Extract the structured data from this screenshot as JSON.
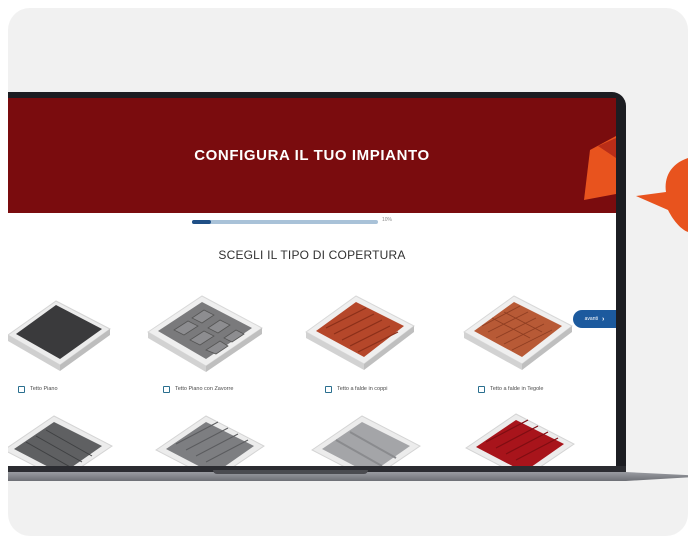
{
  "hero": {
    "title": "CONFIGURA IL TUO IMPIANTO"
  },
  "progress": {
    "value_fraction": 0.1,
    "label": "10%"
  },
  "section": {
    "title": "SCEGLI IL TIPO DI COPERTURA"
  },
  "options": [
    {
      "label": "Tetto Piano",
      "icon": "flat-roof-icon"
    },
    {
      "label": "Tetto Piano con Zavorre",
      "icon": "ballasted-flat-roof-icon"
    },
    {
      "label": "Tetto a falde in coppi",
      "icon": "clay-tile-roof-icon"
    },
    {
      "label": "Tetto a falde in Tegole",
      "icon": "roof-tile-roof-icon"
    }
  ],
  "next_button": {
    "label": "avanti"
  },
  "colors": {
    "hero_red": "#7a0c0e",
    "accent_orange": "#e8531e",
    "progress_fill": "#1f4f86",
    "progress_track": "#a9c2d8",
    "next_blue": "#1c5a9e"
  }
}
